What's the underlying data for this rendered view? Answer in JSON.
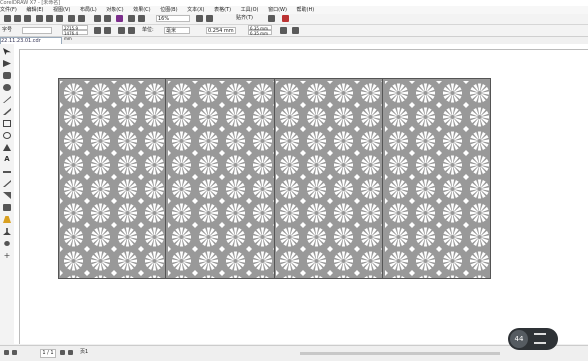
{
  "window": {
    "title": "CorelDRAW X7 - [未命名]"
  },
  "menu": [
    "文件(F)",
    "编辑(E)",
    "视图(V)",
    "布局(L)",
    "对象(C)",
    "效果(C)",
    "位图(B)",
    "文本(X)",
    "表格(T)",
    "工具(O)",
    "窗口(W)",
    "帮助(H)"
  ],
  "toolbar": {
    "zoom_value": "16%",
    "snap_label": "贴齐(T)"
  },
  "propbar": {
    "font_label": "字号",
    "width": "2715.9 mm",
    "height": "1476.4 mm",
    "units_label": "单位:",
    "units_value": "毫米",
    "nudge": "0.254 mm",
    "dup_x": "6.35 mm",
    "dup_y": "6.35 mm"
  },
  "document": {
    "tab_label": "22.11.23.01.cdr"
  },
  "status": {
    "page": "1 / 1",
    "page_tab": "页1"
  },
  "zoom_widget": {
    "value": "44"
  },
  "colors": {
    "panel_fill": "#999999",
    "panel_border": "#555555",
    "accent": "#2e3236"
  }
}
